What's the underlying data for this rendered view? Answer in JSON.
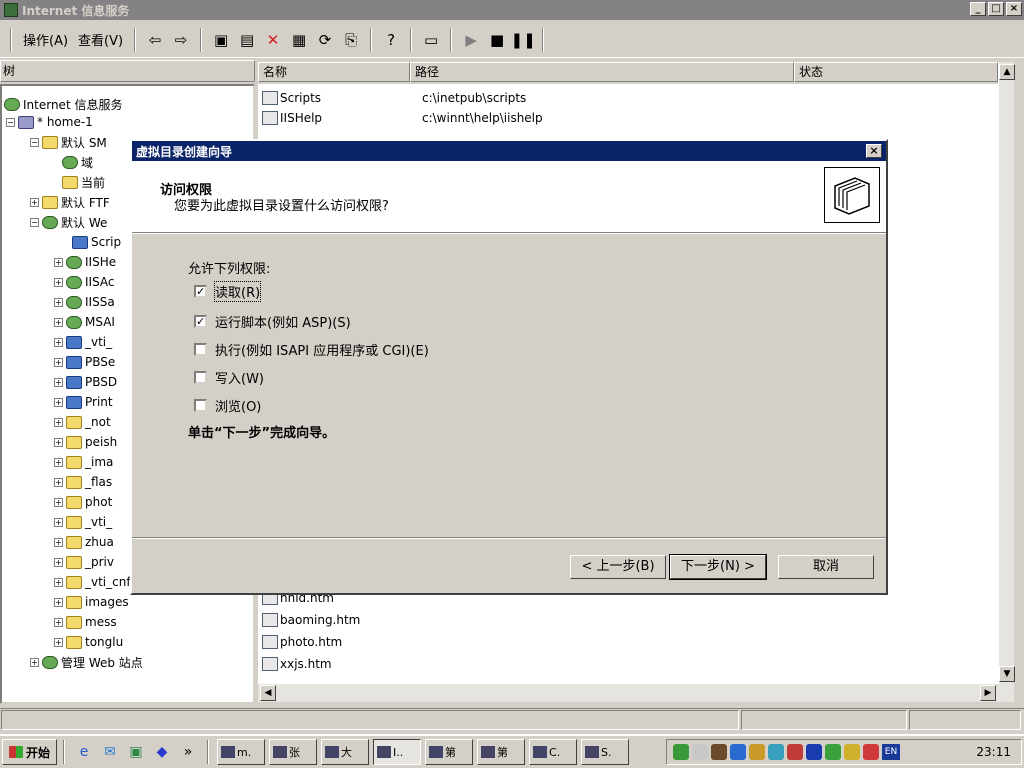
{
  "window": {
    "title": "Internet 信息服务",
    "min": "_",
    "max": "□",
    "close": "×"
  },
  "menu": {
    "action": "操作(A)",
    "view": "查看(V)"
  },
  "tree": {
    "header": "树",
    "items": [
      {
        "label": "Internet 信息服务",
        "icon": "globe"
      },
      {
        "label": "* home-1",
        "icon": "server"
      },
      {
        "label": "默认 SM",
        "icon": "folder"
      },
      {
        "label": "域",
        "icon": "globe"
      },
      {
        "label": "当前",
        "icon": "folder"
      },
      {
        "label": "默认 FTF",
        "icon": "folder"
      },
      {
        "label": "默认 We",
        "icon": "globe"
      },
      {
        "label": "Scrip",
        "icon": "web"
      },
      {
        "label": "IISHe",
        "icon": "globe"
      },
      {
        "label": "IISAc",
        "icon": "globe"
      },
      {
        "label": "IISSa",
        "icon": "globe"
      },
      {
        "label": "MSAI",
        "icon": "globe"
      },
      {
        "label": "_vti_",
        "icon": "web"
      },
      {
        "label": "PBSe",
        "icon": "web"
      },
      {
        "label": "PBSD",
        "icon": "web"
      },
      {
        "label": "Print",
        "icon": "web"
      },
      {
        "label": "_not",
        "icon": "folder"
      },
      {
        "label": "peish",
        "icon": "folder"
      },
      {
        "label": "_ima",
        "icon": "folder"
      },
      {
        "label": "_flas",
        "icon": "folder"
      },
      {
        "label": "phot",
        "icon": "folder"
      },
      {
        "label": "_vti_",
        "icon": "folder"
      },
      {
        "label": "zhua",
        "icon": "folder"
      },
      {
        "label": "_priv",
        "icon": "folder"
      },
      {
        "label": "_vti_cnf",
        "icon": "folder"
      },
      {
        "label": "images",
        "icon": "folder"
      },
      {
        "label": "mess",
        "icon": "folder"
      },
      {
        "label": "tonglu",
        "icon": "folder"
      },
      {
        "label": "管理 Web 站点",
        "icon": "globe"
      }
    ]
  },
  "list": {
    "columns": {
      "name": "名称",
      "path": "路径",
      "status": "状态"
    },
    "rows": [
      {
        "name": "Scripts",
        "path": "c:\\inetpub\\scripts"
      },
      {
        "name": "IISHelp",
        "path": "c:\\winnt\\help\\iishelp"
      },
      {
        "name": "hnld.htm",
        "path": ""
      },
      {
        "name": "baoming.htm",
        "path": ""
      },
      {
        "name": "photo.htm",
        "path": ""
      },
      {
        "name": "xxjs.htm",
        "path": ""
      }
    ]
  },
  "dialog": {
    "title": "虚拟目录创建向导",
    "close": "×",
    "heading": "访问权限",
    "subheading": "您要为此虚拟目录设置什么访问权限?",
    "allow_label": "允许下列权限:",
    "permissions": [
      {
        "label": "读取(R)",
        "checked": true
      },
      {
        "label": "运行脚本(例如 ASP)(S)",
        "checked": true
      },
      {
        "label": "执行(例如 ISAPI 应用程序或 CGI)(E)",
        "checked": false
      },
      {
        "label": "写入(W)",
        "checked": false
      },
      {
        "label": "浏览(O)",
        "checked": false
      }
    ],
    "finish_note": "单击“下一步”完成向导。",
    "buttons": {
      "back": "< 上一步(B)",
      "next": "下一步(N) >",
      "cancel": "取消"
    }
  },
  "taskbar": {
    "start": "开始",
    "overflow": "»",
    "tasks": [
      {
        "label": "m."
      },
      {
        "label": "张"
      },
      {
        "label": "大"
      },
      {
        "label": "I.."
      },
      {
        "label": "第"
      },
      {
        "label": "第"
      },
      {
        "label": "C."
      },
      {
        "label": "S."
      }
    ],
    "lang": "EN",
    "clock": "23:11"
  }
}
